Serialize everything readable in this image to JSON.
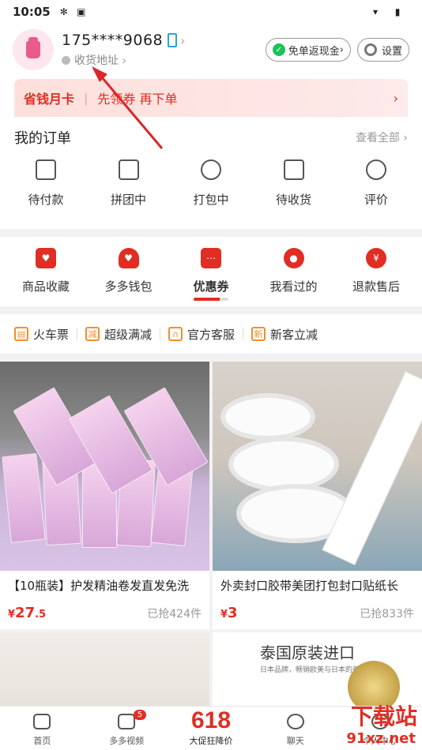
{
  "status_bar": {
    "time": "10:05"
  },
  "profile": {
    "phone": "175****9068",
    "address_link": "收货地址",
    "cashback_button": "免单返现金",
    "settings_button": "设置"
  },
  "banner": {
    "title": "省钱月卡",
    "text": "先领券 再下单"
  },
  "orders": {
    "title": "我的订单",
    "view_all": "查看全部",
    "items": [
      {
        "label": "待付款",
        "icon": "wallet-icon"
      },
      {
        "label": "拼团中",
        "icon": "share-box-icon"
      },
      {
        "label": "打包中",
        "icon": "clock-icon"
      },
      {
        "label": "待收货",
        "icon": "truck-icon"
      },
      {
        "label": "评价",
        "icon": "review-icon"
      }
    ]
  },
  "favorites": {
    "items": [
      {
        "label": "商品收藏",
        "icon": "bag-heart-icon"
      },
      {
        "label": "多多钱包",
        "icon": "wallet-heart-icon"
      },
      {
        "label": "优惠券",
        "icon": "coupon-icon"
      },
      {
        "label": "我看过的",
        "icon": "footprint-icon"
      },
      {
        "label": "退款售后",
        "icon": "yuan-icon"
      }
    ],
    "active": "优惠券"
  },
  "quick_links": [
    {
      "label": "火车票",
      "icon": "train-icon"
    },
    {
      "label": "超级满减",
      "icon": "discount-icon"
    },
    {
      "label": "官方客服",
      "icon": "headset-icon"
    },
    {
      "label": "新客立减",
      "icon": "new-icon"
    }
  ],
  "products": [
    {
      "name": "【10瓶装】护发精油卷发直发免洗",
      "currency": "¥",
      "price_int": "27",
      "price_dec": ".5",
      "sold": "已抢424件"
    },
    {
      "name": "外卖封口胶带美团打包封口贴纸长",
      "currency": "¥",
      "price_int": "3",
      "price_dec": "",
      "sold": "已抢833件"
    },
    {
      "name": "",
      "currency": "",
      "price_int": "",
      "price_dec": "",
      "sold": ""
    },
    {
      "image_title": "泰国原装进口",
      "image_sub": "日本品牌，畅销欧美与日本的美容将军"
    }
  ],
  "bottom_nav": [
    {
      "label": "首页",
      "icon": "home-icon"
    },
    {
      "label": "多多视频",
      "icon": "video-icon",
      "badge": "5"
    },
    {
      "label": "大促狂降价",
      "big": "618"
    },
    {
      "label": "聊天",
      "icon": "chat-icon"
    },
    {
      "label": "个人中心",
      "icon": "person-icon"
    }
  ],
  "watermark": {
    "text": "下载站",
    "sub": "91xz.net"
  }
}
